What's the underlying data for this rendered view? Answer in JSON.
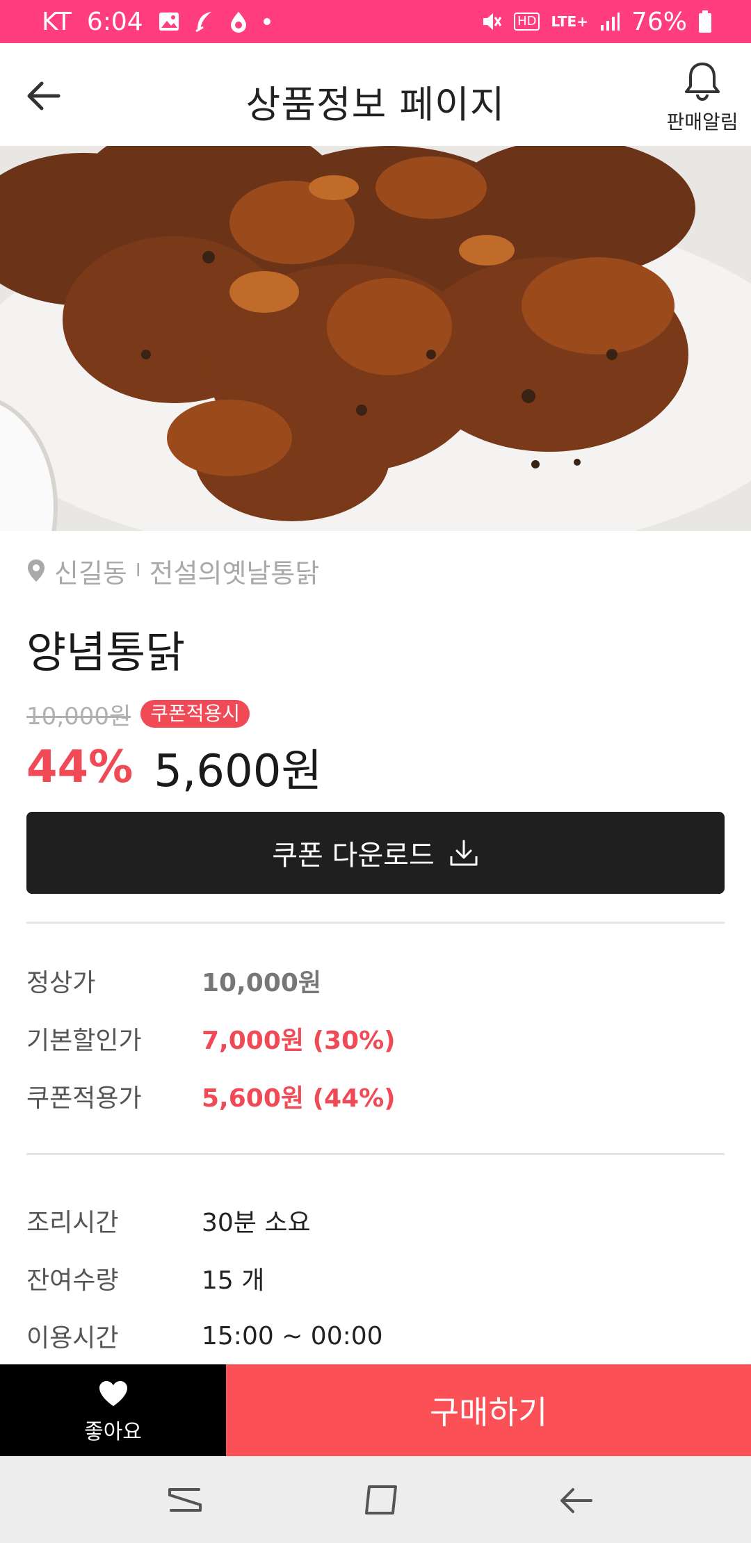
{
  "status_bar": {
    "carrier": "KT",
    "time": "6:04",
    "hd_label": "HD",
    "network": "LTE+",
    "battery": "76%"
  },
  "header": {
    "title": "상품정보 페이지",
    "alarm_label": "판매알림"
  },
  "product": {
    "location": "신길동",
    "separator": "I",
    "store": "전설의옛날통닭",
    "name": "양념통닭",
    "original_price": "10,000원",
    "coupon_badge": "쿠폰적용시",
    "discount_rate": "44%",
    "final_price": "5,600원"
  },
  "coupon_button": {
    "label": "쿠폰 다운로드"
  },
  "price_info": [
    {
      "label": "정상가",
      "value": "10,000원"
    },
    {
      "label": "기본할인가",
      "value": "7,000원 (30%)"
    },
    {
      "label": "쿠폰적용가",
      "value": "5,600원 (44%)"
    }
  ],
  "detail_info": [
    {
      "label": "조리시간",
      "value": "30분 소요"
    },
    {
      "label": "잔여수량",
      "value": "15 개"
    },
    {
      "label": "이용시간",
      "value": "15:00 ~ 00:00"
    }
  ],
  "bottom_bar": {
    "like_label": "좋아요",
    "buy_label": "구매하기"
  },
  "colors": {
    "status_bar": "#ff3d7f",
    "accent_red": "#ef4a55",
    "buy_button": "#fb5156",
    "dark_button": "#1f1f1f"
  }
}
